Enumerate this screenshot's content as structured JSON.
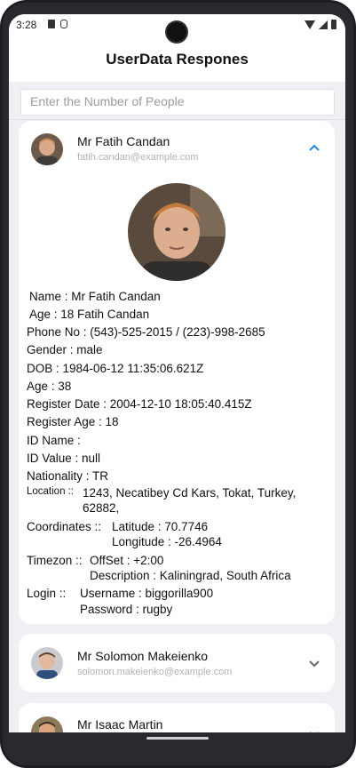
{
  "status_bar": {
    "time": "3:28"
  },
  "app_bar": {
    "title": "UserData Respones"
  },
  "search": {
    "placeholder": "Enter the Number of People"
  },
  "users": [
    {
      "name": "Mr Fatih Candan",
      "email": "fatih.candan@example.com",
      "expanded": true,
      "details": {
        "name_line": "Name : Mr Fatih Candan",
        "age_name_line": "Age : 18 Fatih Candan",
        "phone_line": "Phone No : (543)-525-2015 / (223)-998-2685",
        "gender_line": "Gender : male",
        "dob_line": "DOB : 1984-06-12 11:35:06.621Z",
        "age_line": "Age : 38",
        "register_date_line": "Register Date : 2004-12-10 18:05:40.415Z",
        "register_age_line": "Register Age : 18",
        "id_name_line": "ID Name :",
        "id_value_line": "ID Value : null",
        "nationality_line": "Nationality : TR",
        "location_label": "Location ::",
        "location_value_1": "1243, Necatibey Cd Kars, Tokat, Turkey,",
        "location_value_2": "62882,",
        "coordinates_label": "Coordinates ::",
        "latitude_line": "Latitude : 70.7746",
        "longitude_line": "Longitude : -26.4964",
        "timezone_label": "Timezon ::",
        "offset_line": "OffSet : +2:00",
        "description_line": "Description : Kaliningrad, South Africa",
        "login_label": "Login ::",
        "username_line": "Username : biggorilla900",
        "password_line": "Password : rugby"
      }
    },
    {
      "name": "Mr Solomon Makeienko",
      "email": "solomon.makeienko@example.com",
      "expanded": false
    },
    {
      "name": "Mr Isaac Martin",
      "email": "",
      "expanded": false
    }
  ],
  "colors": {
    "accent": "#1e88e5",
    "chevron_collapsed": "#666666"
  },
  "icons": [
    "chevron-up-icon",
    "chevron-down-icon"
  ]
}
